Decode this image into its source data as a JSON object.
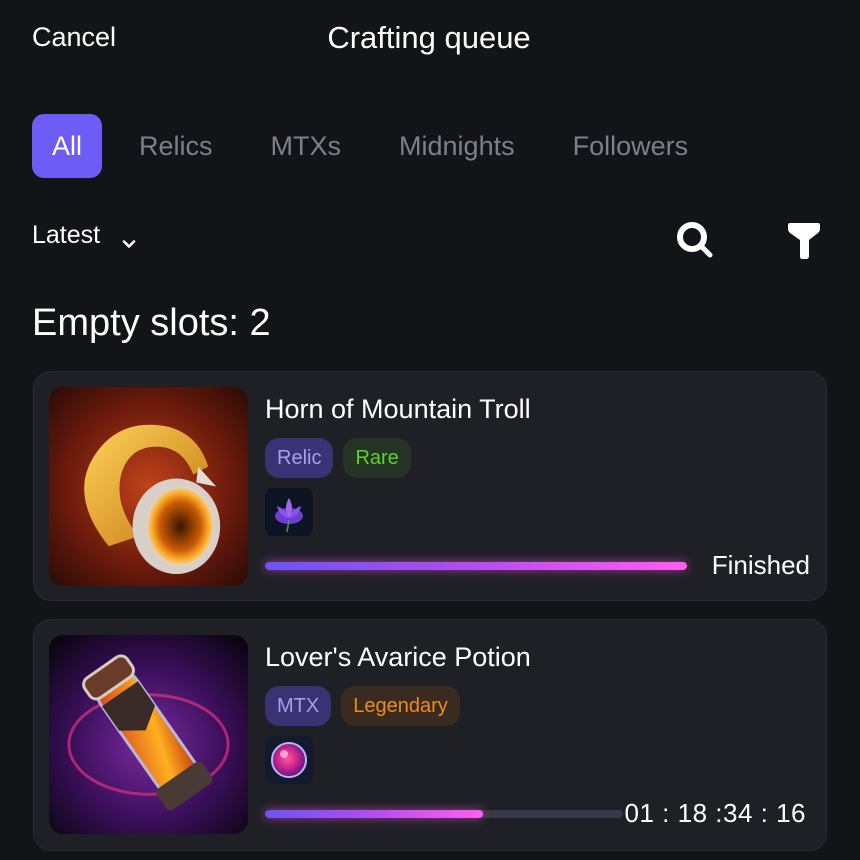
{
  "header": {
    "cancel_label": "Cancel",
    "title": "Crafting queue"
  },
  "tabs": [
    {
      "label": "All",
      "active": true
    },
    {
      "label": "Relics",
      "active": false
    },
    {
      "label": "MTXs",
      "active": false
    },
    {
      "label": "Midnights",
      "active": false
    },
    {
      "label": "Followers",
      "active": false
    }
  ],
  "toolbar": {
    "sort_value": "Latest",
    "sort_icon": "chevron-down-icon",
    "search_icon": "search-icon",
    "filter_icon": "filter-icon"
  },
  "slots_label": "Empty slots: 2",
  "items": [
    {
      "name": "Horn of Mountain Troll",
      "tags": [
        {
          "label": "Relic",
          "color": "#a99df0",
          "bg": "#3a3272"
        },
        {
          "label": "Rare",
          "color": "#5ed12a",
          "bg": "#263425"
        }
      ],
      "image_icon": "horn-icon",
      "material_icon": "lotus-flower-icon",
      "progress": 1.0,
      "status": "Finished"
    },
    {
      "name": "Lover's Avarice Potion",
      "tags": [
        {
          "label": "MTX",
          "color": "#a99df0",
          "bg": "#3a3272"
        },
        {
          "label": "Legendary",
          "color": "#f08a1e",
          "bg": "#3a2b20"
        }
      ],
      "image_icon": "potion-icon",
      "material_icon": "pink-orb-icon",
      "progress": 0.61,
      "status": "01 : 18 :34 : 16"
    }
  ],
  "colors": {
    "background": "#131418",
    "card": "#1f2025",
    "accent": "#6e5cf6",
    "tab_inactive": "#7f7f8c",
    "progress_start": "#6a54f5",
    "progress_end": "#ff5ff0"
  }
}
